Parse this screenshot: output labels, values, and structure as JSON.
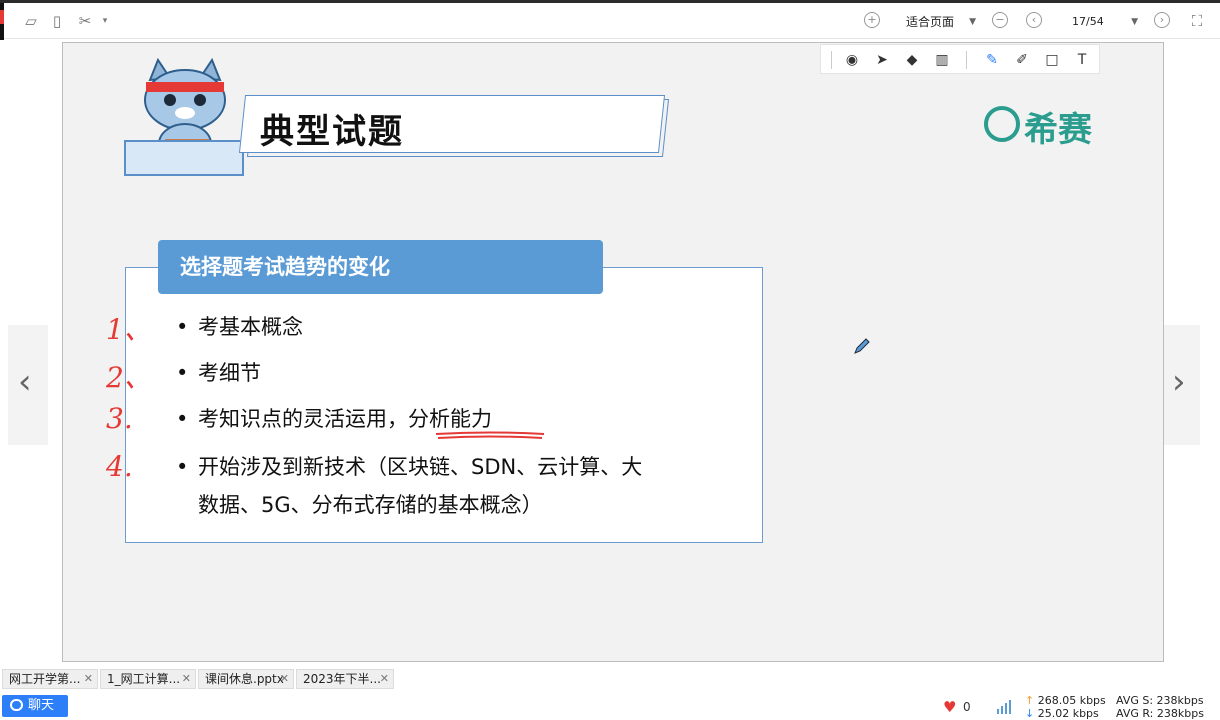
{
  "toolbar": {
    "zoom_label": "适合页面",
    "page_indicator": "17/54"
  },
  "slide": {
    "title": "典型试题",
    "logo_text": "希赛",
    "card_header": "选择题考试趋势的变化",
    "bullets": [
      "考基本概念",
      "考细节",
      "考知识点的灵活运用，",
      "开始涉及到新技术（区块链、SDN、云计算、大"
    ],
    "bullet3_emphasis": "分析能力",
    "bullet4_cont": "数据、5G、分布式存储的基本概念）",
    "handwritten": [
      "1、",
      "2、",
      "3.",
      "4."
    ]
  },
  "tabs": [
    {
      "label": "网工开学第..."
    },
    {
      "label": "1_网工计算..."
    },
    {
      "label": "课间休息.pptx"
    },
    {
      "label": "2023年下半..."
    }
  ],
  "bottom": {
    "chat_label": "聊天",
    "likes": "0",
    "upload_speed": "268.05 kbps",
    "download_speed": "25.02 kbps",
    "avg_s": "AVG S: 238kbps",
    "avg_r": "AVG R: 238kbps"
  },
  "colors": {
    "accent_blue": "#5b9bd5",
    "logo_teal": "#2a9d8f",
    "annotation_red": "#e53935"
  }
}
